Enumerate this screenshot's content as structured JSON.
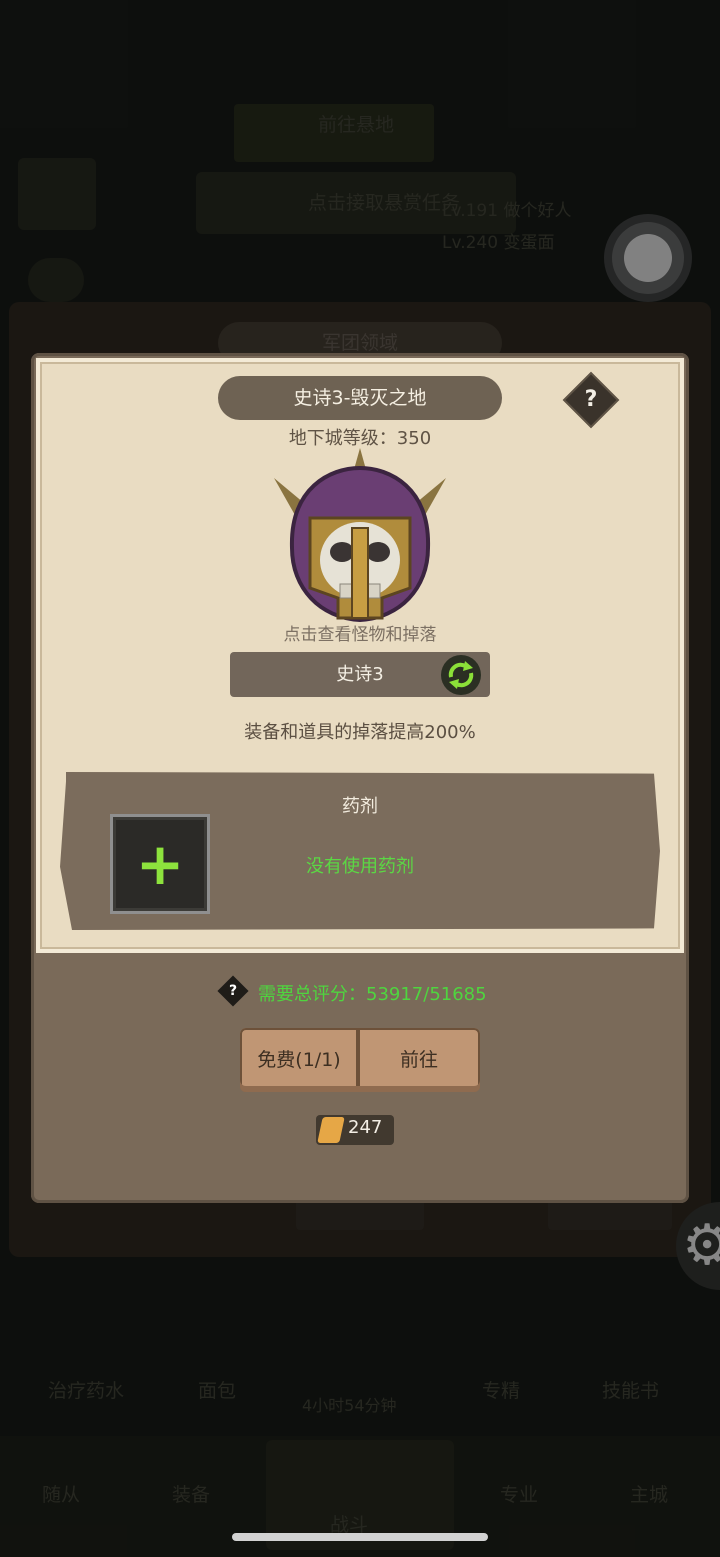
{
  "background": {
    "top_badge": "前往悬地",
    "quest_hint": "点击接取悬赏任务",
    "quest_line1": "Lv.191 做个好人",
    "quest_line2": "Lv.240 变蛋面",
    "outer_title": "军团领域",
    "bottom_items": [
      "治疗药水",
      "面包",
      "4小时54分钟",
      "专精",
      "技能书"
    ],
    "bottom_nav": [
      "随从",
      "装备",
      "战斗",
      "专业",
      "主城"
    ]
  },
  "dialog": {
    "title": "史诗3-毁灭之地",
    "help_icon": "?",
    "level_label": "地下城等级：350",
    "monster_hint": "点击查看怪物和掉落",
    "difficulty_label": "史诗3",
    "drop_bonus": "装备和道具的掉落提高200%",
    "potion": {
      "title": "药剂",
      "add_symbol": "+",
      "status": "没有使用药剂"
    },
    "requirement": {
      "help_icon": "?",
      "text": "需要总评分：53917/51685"
    },
    "free_button": "免费(1/1)",
    "go_button": "前往",
    "scroll_count": "247"
  },
  "colors": {
    "accent_green": "#4fd53f",
    "paper": "#e9dcc2",
    "panel": "#7a6a59"
  }
}
